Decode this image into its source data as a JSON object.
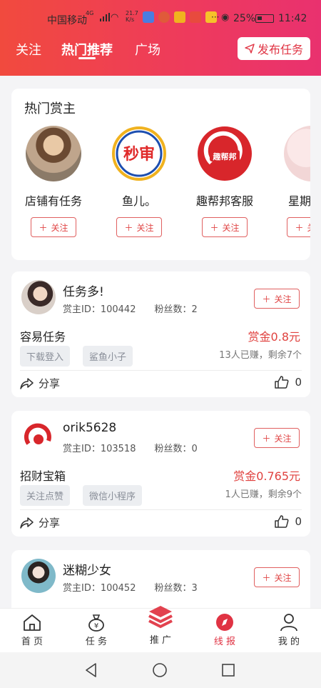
{
  "status_bar": {
    "carrier": "中国移动",
    "net_type": "4G",
    "speed_top": "21.7",
    "speed_bottom": "K/s",
    "battery": "25%",
    "time": "11:42"
  },
  "tabs": [
    "关注",
    "热门推荐",
    "广场"
  ],
  "publish_label": "发布任务",
  "hot_owners": {
    "title": "热门赏主",
    "items": [
      {
        "name": "店铺有任务",
        "follow": "关注"
      },
      {
        "name": "鱼儿。",
        "follow": "关注"
      },
      {
        "name": "趣帮邦客服",
        "follow": "关注"
      },
      {
        "name": "星期",
        "follow": "关注"
      }
    ]
  },
  "logos": {
    "miaoshen": "秒审",
    "qubangbang": "趣帮邦"
  },
  "tasks": [
    {
      "owner": "任务多!",
      "owner_id_label": "赏主ID：100442",
      "fans_label": "粉丝数：2",
      "follow": "关注",
      "title": "容易任务",
      "reward": "赏金0.8元",
      "tags": [
        "下载登入",
        "鲨鱼小子"
      ],
      "progress": "13人已赚，剩余7个",
      "share": "分享",
      "likes": "0"
    },
    {
      "owner": "orik5628",
      "owner_id_label": "赏主ID：103518",
      "fans_label": "粉丝数：0",
      "follow": "关注",
      "title": "招财宝箱",
      "reward": "赏金0.765元",
      "tags": [
        "关注点赞",
        "微信小程序"
      ],
      "progress": "1人已赚，剩余9个",
      "share": "分享",
      "likes": "0"
    },
    {
      "owner": "迷糊少女",
      "owner_id_label": "赏主ID：100452",
      "fans_label": "粉丝数：3",
      "follow": "关注"
    }
  ],
  "bottom_nav": [
    "首 页",
    "任 务",
    "推 广",
    "线 报",
    "我 的"
  ],
  "colors": {
    "accent": "#e03343",
    "header_start": "#f14a3e",
    "header_end": "#e9316f"
  }
}
